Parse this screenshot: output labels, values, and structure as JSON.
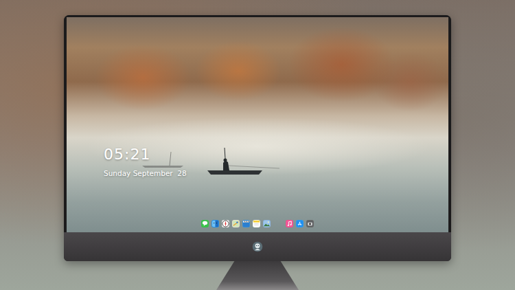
{
  "clock": {
    "time": "05:21",
    "date": "Sunday September  28"
  },
  "dock": {
    "items": [
      {
        "kind": "messages"
      },
      {
        "kind": "finder"
      },
      {
        "kind": "safari"
      },
      {
        "kind": "maps"
      },
      {
        "kind": "clapper"
      },
      {
        "kind": "notes"
      },
      {
        "kind": "photos"
      },
      {
        "kind": "spacer"
      },
      {
        "kind": "music"
      },
      {
        "kind": "appstore"
      },
      {
        "kind": "camera"
      }
    ]
  }
}
